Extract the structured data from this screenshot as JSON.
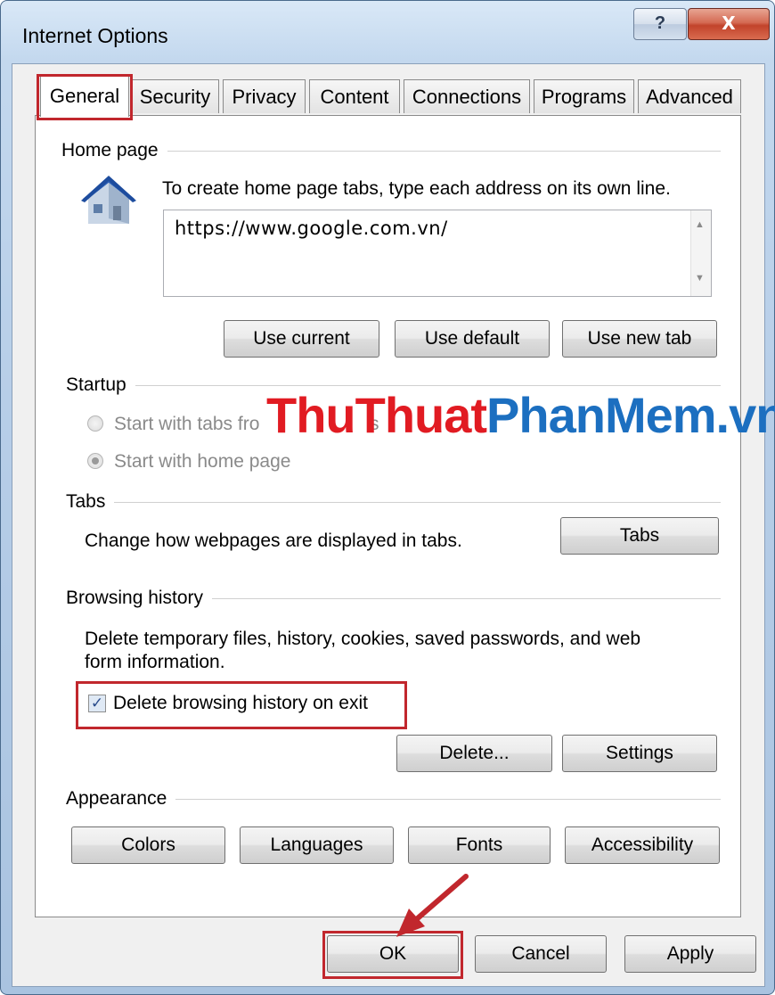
{
  "window": {
    "title": "Internet Options",
    "help_label": "?",
    "close_label": "X"
  },
  "tabs": [
    "General",
    "Security",
    "Privacy",
    "Content",
    "Connections",
    "Programs",
    "Advanced"
  ],
  "home_page": {
    "label": "Home page",
    "instruction": "To create home page tabs, type each address on its own line.",
    "url_value": "https://www.google.com.vn/",
    "buttons": {
      "use_current": "Use current",
      "use_default": "Use default",
      "use_new_tab": "Use new tab"
    }
  },
  "startup": {
    "label": "Startup",
    "option_tabs": "Start with tabs fro",
    "option_tabs_tail": "s",
    "option_home": "Start with home page"
  },
  "tabs_group": {
    "label": "Tabs",
    "description": "Change how webpages are displayed in tabs.",
    "button": "Tabs"
  },
  "browsing_history": {
    "label": "Browsing history",
    "description_line1": "Delete temporary files, history, cookies, saved passwords, and web",
    "description_line2": "form information.",
    "checkbox_label": "Delete browsing history on exit",
    "checkbox_checked": true,
    "delete_button": "Delete...",
    "settings_button": "Settings"
  },
  "appearance": {
    "label": "Appearance",
    "buttons": {
      "colors": "Colors",
      "languages": "Languages",
      "fonts": "Fonts",
      "accessibility": "Accessibility"
    }
  },
  "footer": {
    "ok": "OK",
    "cancel": "Cancel",
    "apply": "Apply"
  },
  "watermark": {
    "part1": "ThuThuat",
    "part2": "PhanMem",
    "part3": ".vn"
  },
  "colors": {
    "highlight": "#c1272d",
    "watermark_red": "#e11b22",
    "watermark_blue": "#1c6fc0"
  }
}
